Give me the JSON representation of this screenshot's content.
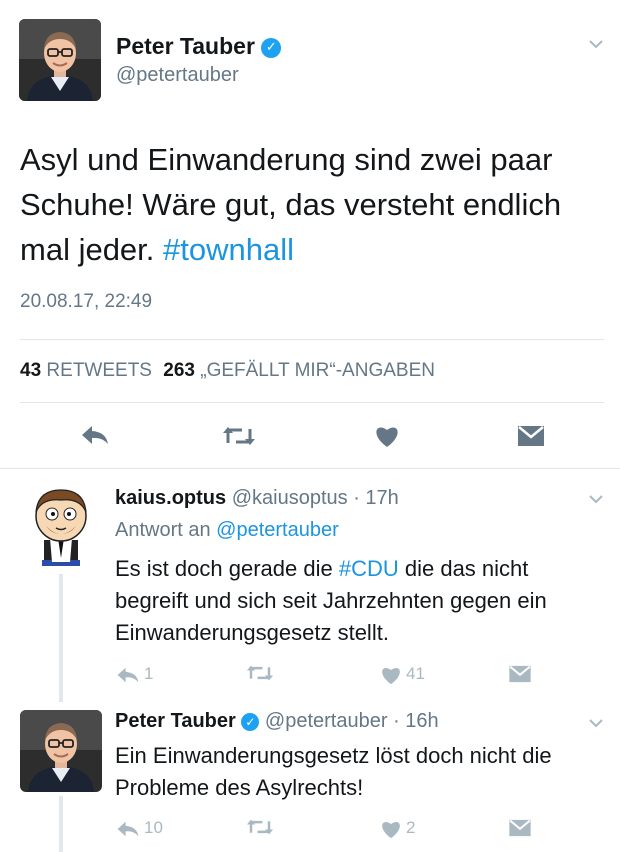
{
  "main_tweet": {
    "name": "Peter Tauber",
    "handle": "@petertauber",
    "text_plain": "Asyl und Einwanderung sind zwei paar Schuhe! Wäre gut, das versteht endlich mal jeder.",
    "hashtag": "#townhall",
    "timestamp": "20.08.17, 22:49",
    "retweets_count": "43",
    "retweets_label": "RETWEETS",
    "likes_count": "263",
    "likes_label": "„GEFÄLLT MIR“-ANGABEN"
  },
  "replies": [
    {
      "name": "kaius.optus",
      "handle": "@kaiusoptus",
      "time": "· 17h",
      "reply_to_label": "Antwort an",
      "reply_to_handle": "@petertauber",
      "text_before": "Es ist doch gerade die",
      "hashtag": "#CDU",
      "text_after": "die das nicht begreift und sich seit Jahrzehnten gegen ein  Einwanderungsgesetz stellt.",
      "reply_count": "1",
      "like_count": "41"
    },
    {
      "name": "Peter Tauber",
      "handle": "@petertauber",
      "time": "· 16h",
      "text": "Ein Einwanderungsgesetz löst doch nicht die Probleme des Asylrechts!",
      "reply_count": "10",
      "like_count": "2"
    }
  ],
  "icons": [
    "verified-badge-icon",
    "chevron-down-icon",
    "reply-icon",
    "retweet-icon",
    "heart-icon",
    "direct-message-icon"
  ],
  "colors": {
    "link_blue": "#1b95e0",
    "verified_blue": "#1da1f2",
    "icon_gray": "#aab8c2",
    "text_gray": "#657786",
    "divider": "#e1e8ed"
  }
}
